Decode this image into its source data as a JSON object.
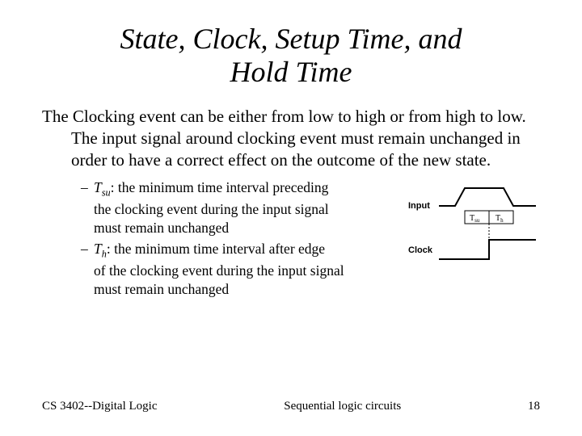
{
  "title_line1": "State, Clock, Setup Time, and",
  "title_line2": "Hold Time",
  "paragraph": "The Clocking event can be either from low to high or from high to low. The input signal around clocking event must remain unchanged in order to have a correct effect on the outcome of the new state.",
  "bullet1": {
    "var": "T",
    "sub": "su",
    "text1": ": the minimum time interval preceding",
    "text2": "the clocking event during the input signal",
    "text3": "must remain unchanged"
  },
  "bullet2": {
    "var": "T",
    "sub": "h",
    "text1": ": the minimum time interval after edge",
    "text2": "of the clocking event during the input signal",
    "text3": "must remain unchanged"
  },
  "figure": {
    "input_label": "Input",
    "clock_label": "Clock",
    "tsu_label": "Tsu",
    "th_label": "Th"
  },
  "footer": {
    "left": "CS 3402--Digital Logic",
    "center": "Sequential logic circuits",
    "right": "18"
  }
}
